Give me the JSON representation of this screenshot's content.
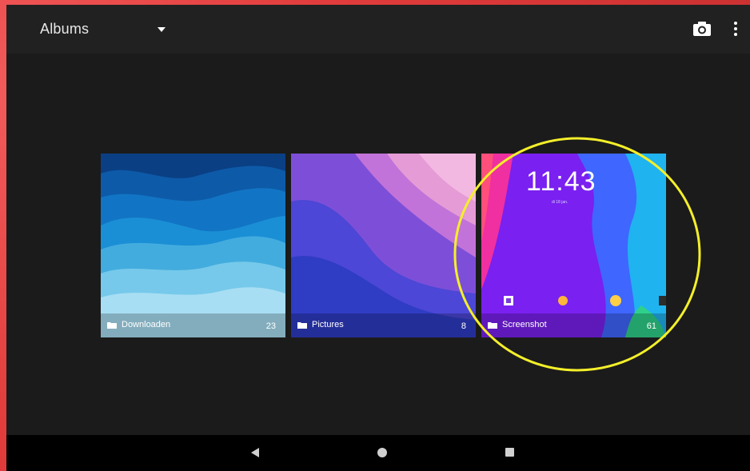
{
  "appbar": {
    "title": "Albums",
    "dropdown_icon": "arrow-drop-down-icon",
    "camera_icon": "camera-icon",
    "menu_icon": "more-vert-icon"
  },
  "albums": [
    {
      "name": "Downloaden",
      "count": "23",
      "icon": "folder-icon"
    },
    {
      "name": "Pictures",
      "count": "8",
      "icon": "folder-icon"
    },
    {
      "name": "Screenshot",
      "count": "61",
      "icon": "folder-icon"
    }
  ],
  "screenshot_thumb": {
    "time": "11:43",
    "date": "di 18 jan."
  },
  "annotation": {
    "color": "#f4ef2a",
    "shape": "circle"
  },
  "navbar": {
    "back_icon": "back-icon",
    "home_icon": "home-icon",
    "recents_icon": "recents-icon"
  },
  "colors": {
    "appbar": "#212121",
    "background": "#1b1b1b",
    "navbar": "#000000"
  }
}
